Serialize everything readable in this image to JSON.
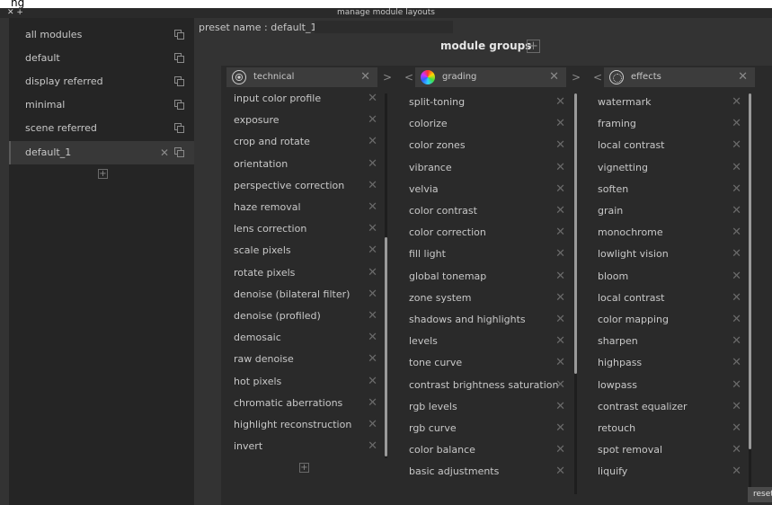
{
  "top_strip_glyph": "ng",
  "titlebar": {
    "controls": "✕ +",
    "title": "manage module layouts"
  },
  "sidebar": {
    "items": [
      {
        "label": "all modules"
      },
      {
        "label": "default"
      },
      {
        "label": "display referred"
      },
      {
        "label": "minimal"
      },
      {
        "label": "scene referred"
      },
      {
        "label": "default_1",
        "active": true
      }
    ],
    "add_symbol": "+",
    "delete_symbol": "✕"
  },
  "preset": {
    "label": "preset name : default_1"
  },
  "groups": {
    "header": "module groups",
    "add_symbol": "+",
    "columns": [
      {
        "name": "technical",
        "icon": "technical-icon",
        "modules": [
          "input color profile",
          "exposure",
          "crop and rotate",
          "orientation",
          "perspective correction",
          "haze removal",
          "lens correction",
          "scale pixels",
          "rotate pixels",
          "denoise (bilateral filter)",
          "denoise (profiled)",
          "demosaic",
          "raw denoise",
          "hot pixels",
          "chromatic aberrations",
          "highlight reconstruction",
          "invert"
        ]
      },
      {
        "name": "grading",
        "icon": "grading-icon",
        "modules": [
          "split-toning",
          "colorize",
          "color zones",
          "vibrance",
          "velvia",
          "color contrast",
          "color correction",
          "fill light",
          "global tonemap",
          "zone system",
          "shadows and highlights",
          "levels",
          "tone curve",
          "contrast brightness saturation",
          "rgb levels",
          "rgb curve",
          "color balance",
          "basic adjustments"
        ]
      },
      {
        "name": "effects",
        "icon": "effects-icon",
        "modules": [
          "watermark",
          "framing",
          "local contrast",
          "vignetting",
          "soften",
          "grain",
          "monochrome",
          "lowlight vision",
          "bloom",
          "local contrast",
          "color mapping",
          "sharpen",
          "highpass",
          "lowpass",
          "contrast equalizer",
          "retouch",
          "spot removal",
          "liquify"
        ]
      }
    ],
    "close_symbol": "✕",
    "arrow_left": "<",
    "arrow_right": ">"
  },
  "reset_label": "reset"
}
